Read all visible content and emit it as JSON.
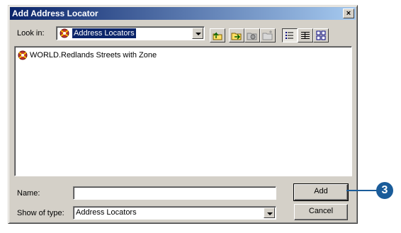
{
  "window": {
    "title": "Add Address Locator",
    "close_label": "×"
  },
  "lookin": {
    "label": "Look in:",
    "value": "Address Locators"
  },
  "toolbar": {
    "buttons": [
      "up-one-level",
      "connect-folder",
      "disconnect-folder",
      "new-folder",
      "list-view",
      "details-view",
      "thumbnails-view"
    ]
  },
  "list": {
    "items": [
      {
        "label": "WORLD.Redlands Streets with Zone",
        "icon": "address-locator-icon"
      }
    ]
  },
  "name_field": {
    "label": "Name:",
    "value": ""
  },
  "type_field": {
    "label": "Show of type:",
    "value": "Address Locators"
  },
  "buttons": {
    "add": "Add",
    "cancel": "Cancel"
  },
  "callout": {
    "number": "3"
  },
  "colors": {
    "title_start": "#0a246a",
    "title_end": "#a6caf0",
    "dialog_bg": "#d4d0c8",
    "selection": "#0a246a",
    "callout": "#1a5c9a"
  }
}
